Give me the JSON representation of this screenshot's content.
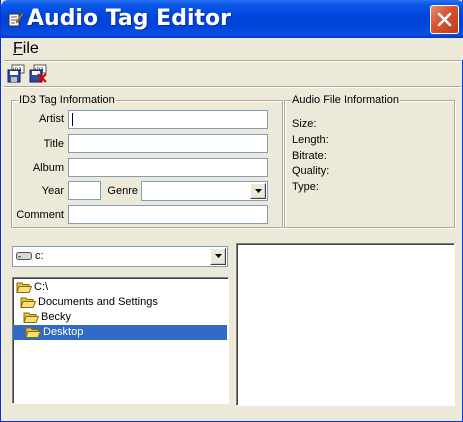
{
  "window": {
    "title": "Audio Tag Editor"
  },
  "menu": {
    "items": [
      "File"
    ]
  },
  "toolbar": {
    "buttons": [
      {
        "icon": "save-tag-icon"
      },
      {
        "icon": "remove-tag-icon"
      }
    ]
  },
  "id3": {
    "legend": "ID3 Tag Information",
    "artist_label": "Artist",
    "artist_value": "",
    "title_label": "Title",
    "title_value": "",
    "album_label": "Album",
    "album_value": "",
    "year_label": "Year",
    "year_value": "",
    "genre_label": "Genre",
    "genre_value": "",
    "comment_label": "Comment",
    "comment_value": ""
  },
  "audio_info": {
    "legend": "Audio File Information",
    "size_label": "Size:",
    "length_label": "Length:",
    "bitrate_label": "Bitrate:",
    "quality_label": "Quality:",
    "type_label": "Type:"
  },
  "drive": {
    "selected": "c:"
  },
  "tree": {
    "items": [
      {
        "label": "C:\\"
      },
      {
        "label": "Documents and Settings"
      },
      {
        "label": "Becky"
      },
      {
        "label": "Desktop",
        "selected": true
      }
    ]
  },
  "colors": {
    "title_bar": "#0a58e8",
    "close_button": "#d8512f",
    "selection": "#316ac5",
    "face": "#ece9d8"
  }
}
